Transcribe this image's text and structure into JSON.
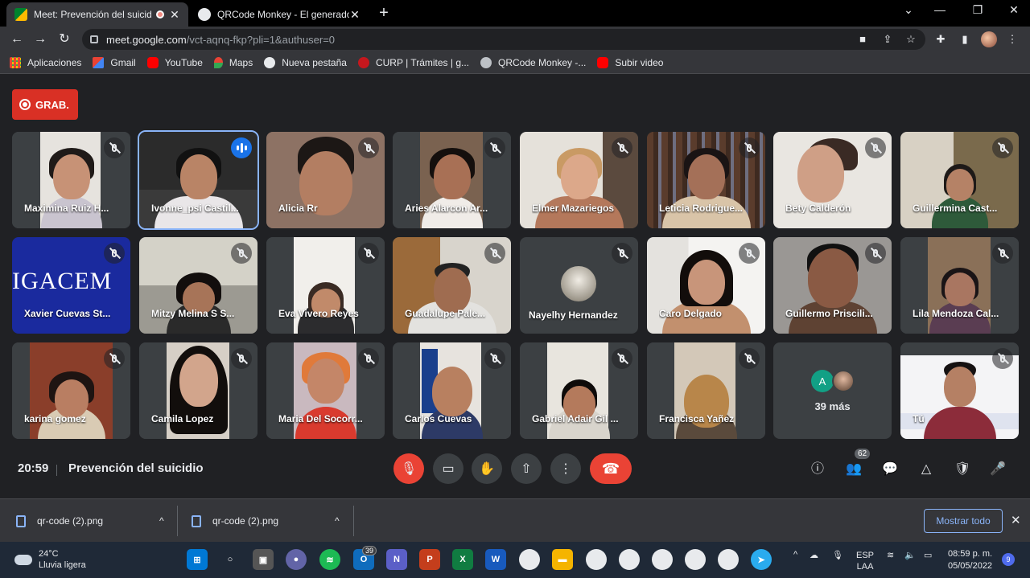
{
  "tabs": [
    {
      "title": "Meet: Prevención del suicidio",
      "active": true
    },
    {
      "title": "QRCode Monkey - El generador d",
      "active": false
    }
  ],
  "address": {
    "host": "meet.google.com",
    "path": "/vct-aqnq-fkp?pli=1&authuser=0"
  },
  "bookmarks": [
    {
      "label": "Aplicaciones",
      "icon": "apps-grid-icon"
    },
    {
      "label": "Gmail",
      "icon": "gmail-icon"
    },
    {
      "label": "YouTube",
      "icon": "youtube-icon"
    },
    {
      "label": "Maps",
      "icon": "maps-pin-icon"
    },
    {
      "label": "Nueva pestaña",
      "icon": "chrome-icon"
    },
    {
      "label": "CURP | Trámites | g...",
      "icon": "gob-icon"
    },
    {
      "label": "QRCode Monkey -...",
      "icon": "qrcode-monkey-icon"
    },
    {
      "label": "Subir video",
      "icon": "youtube-icon"
    }
  ],
  "meet": {
    "recording_label": "GRAB.",
    "time": "20:59",
    "meeting_title": "Prevención del suicidio",
    "participants_count": "62",
    "more_label": "39 más",
    "more_avatar_initial": "A",
    "participants": [
      {
        "name": "Maximina Ruiz H...",
        "muted": true
      },
      {
        "name": "Ivonne_psi Castil...",
        "muted": false,
        "speaking": true
      },
      {
        "name": "Alicia Rr",
        "muted": true
      },
      {
        "name": "Aries Alarcon Ar...",
        "muted": true
      },
      {
        "name": "Elmer Mazariegos",
        "muted": true
      },
      {
        "name": "Leticia Rodrigue...",
        "muted": true
      },
      {
        "name": "Bety Calderón",
        "muted": true
      },
      {
        "name": "Guillermina Cast...",
        "muted": true
      },
      {
        "name": "Xavier Cuevas St...",
        "muted": true
      },
      {
        "name": "Mitzy Melina S S...",
        "muted": true
      },
      {
        "name": "Eva Vivero Reyes",
        "muted": true
      },
      {
        "name": "Guadalupe Pale...",
        "muted": true
      },
      {
        "name": "Nayelhy Hernandez",
        "muted": true
      },
      {
        "name": "Caro Delgado",
        "muted": true
      },
      {
        "name": "Guillermo Priscili...",
        "muted": true
      },
      {
        "name": "Lila Mendoza Cal...",
        "muted": true
      },
      {
        "name": "karina gomez",
        "muted": true
      },
      {
        "name": "Camila Lopez",
        "muted": true
      },
      {
        "name": "Maria Del Socorr...",
        "muted": true
      },
      {
        "name": "Carlos Cuevas",
        "muted": true
      },
      {
        "name": "Gabriel Adair Gil ...",
        "muted": true
      },
      {
        "name": "Francisca Yañez",
        "muted": true
      },
      {
        "name": "Tú",
        "muted": true
      }
    ],
    "igacem_logo_text": "IGACEM"
  },
  "downloads": [
    {
      "filename": "qr-code (2).png"
    },
    {
      "filename": "qr-code (2).png"
    }
  ],
  "show_all_label": "Mostrar todo",
  "taskbar": {
    "temperature": "24°C",
    "weather": "Lluvia ligera",
    "teams_badge": "39",
    "lang_top": "ESP",
    "lang_bottom": "LAA",
    "time": "08:59 p. m.",
    "date": "05/05/2022",
    "notifications": "9"
  },
  "colors": {
    "accent_blue": "#8ab4f8",
    "red": "#ea4335",
    "meet_bg": "#202124"
  }
}
